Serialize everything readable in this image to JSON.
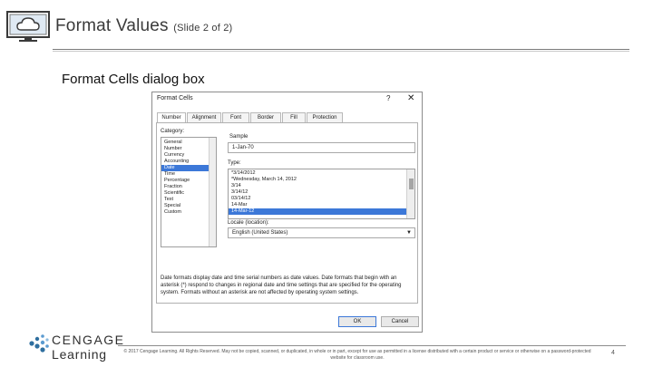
{
  "slide": {
    "title": "Format Values",
    "title_suffix": "(Slide 2 of 2)",
    "caption": "Format Cells dialog box",
    "page_number": "4",
    "copyright": "© 2017 Cengage Learning. All Rights Reserved. May not be copied, scanned, or duplicated, in whole or in part, except for use as permitted in a license distributed with a certain product or service or otherwise on a password-protected website for classroom use.",
    "logo_line1": "CENGAGE",
    "logo_line2": "Learning"
  },
  "dialog": {
    "title": "Format Cells",
    "help": "?",
    "close": "✕",
    "tabs": [
      "Number",
      "Alignment",
      "Font",
      "Border",
      "Fill",
      "Protection"
    ],
    "active_tab": "Number",
    "category_label": "Category:",
    "categories": [
      "General",
      "Number",
      "Currency",
      "Accounting",
      "Date",
      "Time",
      "Percentage",
      "Fraction",
      "Scientific",
      "Text",
      "Special",
      "Custom"
    ],
    "selected_category": "Date",
    "sample_label": "Sample",
    "sample_value": "1-Jan-70",
    "type_label": "Type:",
    "types": [
      "*3/14/2012",
      "*Wednesday, March 14, 2012",
      "3/14",
      "3/14/12",
      "03/14/12",
      "14-Mar",
      "14-Mar-12"
    ],
    "selected_type": "14-Mar-12",
    "locale_label": "Locale (location):",
    "locale_value": "English (United States)",
    "description": "Date formats display date and time serial numbers as date values. Date formats that begin with an asterisk (*) respond to changes in regional date and time settings that are specified for the operating system. Formats without an asterisk are not affected by operating system settings.",
    "ok_label": "OK",
    "cancel_label": "Cancel"
  },
  "colors": {
    "selection": "#3c78d8",
    "logo_accent": "#2f6f9f"
  }
}
